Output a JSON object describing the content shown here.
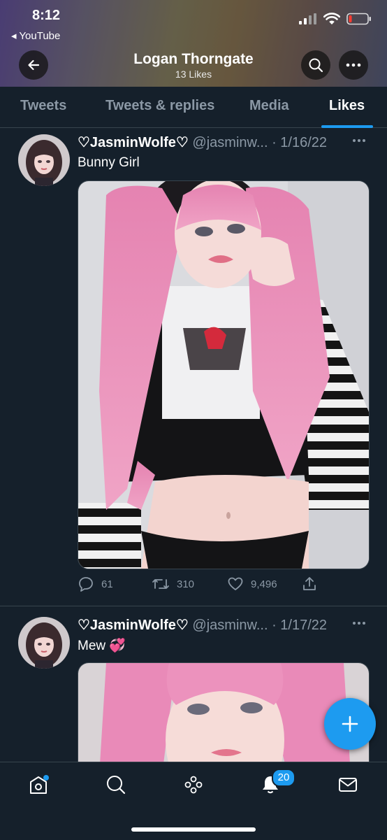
{
  "status_bar": {
    "time": "8:12",
    "back_app": "◂ YouTube"
  },
  "header": {
    "title": "Logan Thorngate",
    "subtitle": "13 Likes"
  },
  "tabs": [
    {
      "label": "Tweets",
      "active": false
    },
    {
      "label": "Tweets & replies",
      "active": false
    },
    {
      "label": "Media",
      "active": false
    },
    {
      "label": "Likes",
      "active": true
    }
  ],
  "tweets": [
    {
      "display_name": "♡JasminWolfe♡",
      "handle_date": "@jasminw... · 1/16/22",
      "text": "Bunny Girl",
      "replies": "61",
      "retweets": "310",
      "likes": "9,496"
    },
    {
      "display_name": "♡JasminWolfe♡",
      "handle_date": "@jasminw... · 1/17/22",
      "text": "Mew 💞"
    }
  ],
  "bottom_nav": {
    "notifications_badge": "20"
  },
  "colors": {
    "background": "#15202b",
    "accent": "#1d9bf0",
    "muted": "#8b98a5",
    "divider": "#38444d"
  }
}
